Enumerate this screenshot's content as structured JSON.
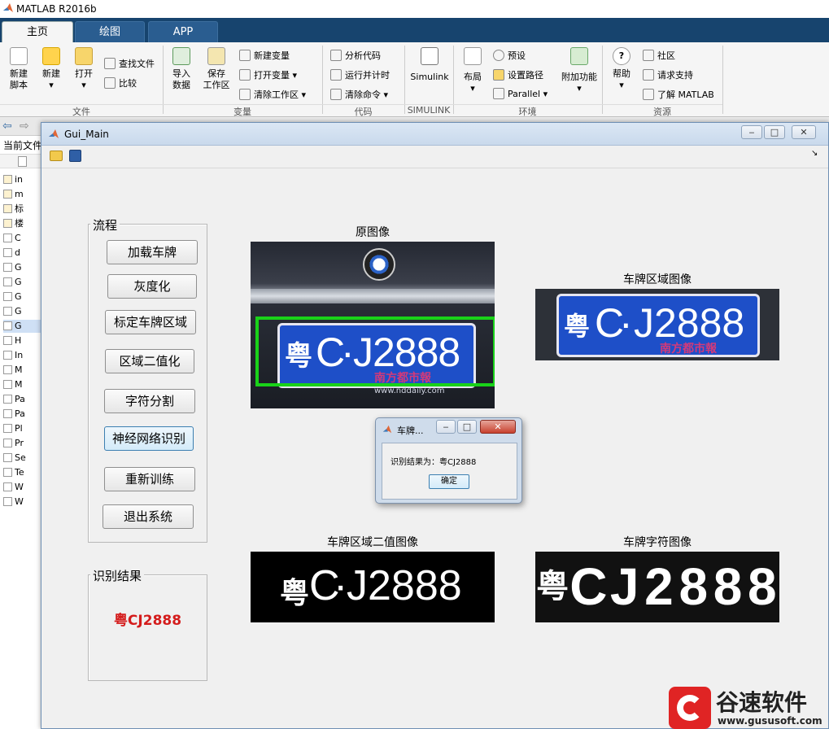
{
  "app": {
    "title": "MATLAB R2016b"
  },
  "tabs": [
    {
      "label": "主页",
      "active": true
    },
    {
      "label": "绘图",
      "active": false
    },
    {
      "label": "APP",
      "active": false
    }
  ],
  "ribbon": {
    "file": {
      "section": "文件",
      "new_script": "新建\n脚本",
      "new": "新建",
      "open": "打开",
      "find_files": "查找文件",
      "compare": "比较"
    },
    "variable": {
      "section": "变量",
      "import_data": "导入\n数据",
      "save_workspace": "保存\n工作区",
      "new_variable": "新建变量",
      "open_variable": "打开变量",
      "clear_workspace": "清除工作区"
    },
    "code": {
      "section": "代码",
      "analyze_code": "分析代码",
      "run_and_time": "运行并计时",
      "clear_commands": "清除命令"
    },
    "simulink": {
      "section": "SIMULINK",
      "label": "Simulink"
    },
    "environment": {
      "section": "环境",
      "layout": "布局",
      "preferences": "预设",
      "set_path": "设置路径",
      "parallel": "Parallel",
      "addons": "附加功能"
    },
    "resources": {
      "section": "资源",
      "help": "帮助",
      "community": "社区",
      "request_support": "请求支持",
      "learn_matlab": "了解 MATLAB"
    }
  },
  "left_pane": {
    "header": "当前文件",
    "items": [
      "in",
      "m",
      "标",
      "楼",
      "C",
      "d",
      "G",
      "G",
      "G",
      "G",
      "G",
      "H",
      "In",
      "M",
      "M",
      "Pa",
      "Pa",
      "Pl",
      "Pr",
      "Se",
      "Te",
      "W",
      "W"
    ]
  },
  "gui": {
    "title": "Gui_Main",
    "process_panel": {
      "title": "流程",
      "buttons": [
        "加载车牌",
        "灰度化",
        "标定车牌区域",
        "区域二值化",
        "字符分割",
        "神经网络识别",
        "重新训练",
        "退出系统"
      ]
    },
    "result_panel": {
      "title": "识别结果",
      "value": "粤CJ2888"
    },
    "captions": {
      "original": "原图像",
      "plate_region": "车牌区域图像",
      "plate_binary": "车牌区域二值图像",
      "plate_chars": "车牌字符图像"
    },
    "plate_text": {
      "province": "粤",
      "letter": "C",
      "dot": "·",
      "number": "J2888",
      "bottom_text": "南方都市報",
      "url": "www.nddaily.com",
      "chars": [
        "粤",
        "C",
        "J",
        "2",
        "8",
        "8",
        "8"
      ]
    }
  },
  "dialog": {
    "title": "车牌...",
    "message": "识别结果为：粤CJ2888",
    "ok": "确定"
  },
  "watermark": {
    "brand": "谷速软件",
    "url": "www.gususoft.com"
  },
  "colors": {
    "ribbon_dark": "#17446e",
    "plate_blue": "#1e4fc8",
    "result_red": "#d41c1c",
    "detect_green": "#19d219"
  }
}
